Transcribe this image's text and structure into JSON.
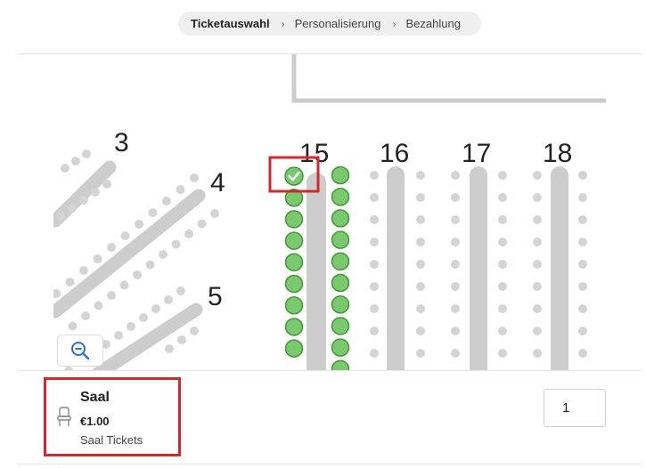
{
  "breadcrumb": {
    "steps": [
      "Ticketauswahl",
      "Personalisierung",
      "Bezahlung"
    ],
    "separator": "›"
  },
  "seatmap": {
    "section_labels": [
      "3",
      "4",
      "5",
      "15",
      "16",
      "17",
      "18"
    ],
    "selected_row": "15",
    "colors": {
      "available": "#7bc96f",
      "available_border": "#3f9a35",
      "unavailable": "#d4d4d4",
      "aisle": "#cdcdcd",
      "highlight": "#d9262b"
    }
  },
  "controls": {
    "zoom_out_icon": "zoom-out-icon"
  },
  "ticket": {
    "icon": "chair-icon",
    "name": "Saal",
    "price": "€1.00",
    "description": "Saal Tickets",
    "quantity": "1"
  }
}
